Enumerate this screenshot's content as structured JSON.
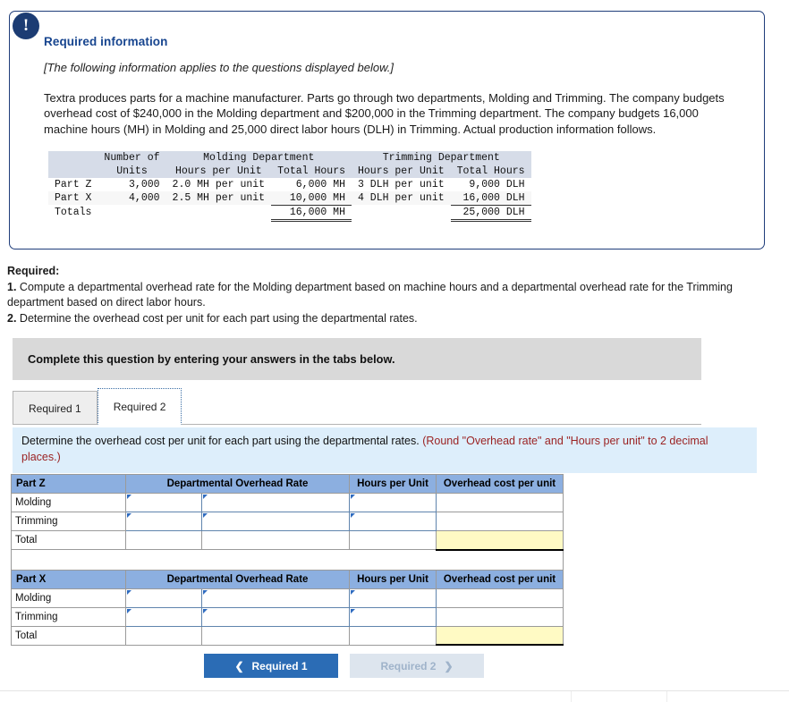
{
  "card": {
    "alert_icon": "exclamation-icon",
    "title": "Required information",
    "italic_note": "[The following information applies to the questions displayed below.]",
    "body": "Textra produces parts for a machine manufacturer. Parts go through two departments, Molding and Trimming. The company budgets overhead cost of $240,000 in the Molding department and $200,000 in the Trimming department. The company budgets 16,000 machine hours (MH) in Molding and 25,000 direct labor hours (DLH) in Trimming. Actual production information follows."
  },
  "data_table": {
    "group_headers": {
      "blank": "",
      "number_of": "Number of",
      "molding": "Molding Department",
      "trimming": "Trimming Department"
    },
    "sub_headers": {
      "blank": "",
      "units": "Units",
      "molding_hours_per_unit": "Hours per Unit",
      "molding_total_hours": "Total Hours",
      "trimming_hours_per_unit": "Hours per Unit",
      "trimming_total_hours": "Total Hours"
    },
    "rows": [
      {
        "part": "Part Z",
        "units": "3,000",
        "molding_hpu": "2.0 MH per unit",
        "molding_total": "6,000 MH",
        "trimming_hpu": "3 DLH per unit",
        "trimming_total": "9,000 DLH"
      },
      {
        "part": "Part X",
        "units": "4,000",
        "molding_hpu": "2.5 MH per unit",
        "molding_total": "10,000 MH",
        "trimming_hpu": "4 DLH per unit",
        "trimming_total": "16,000 DLH"
      }
    ],
    "totals": {
      "label": "Totals",
      "units": "",
      "molding_hpu": "",
      "molding_total": "16,000 MH",
      "trimming_hpu": "",
      "trimming_total": "25,000 DLH"
    }
  },
  "required": {
    "heading": "Required:",
    "item1_number": "1.",
    "item1_text": "Compute a departmental overhead rate for the Molding department based on machine hours and a departmental overhead rate for the Trimming department based on direct labor hours.",
    "item2_number": "2.",
    "item2_text": "Determine the overhead cost per unit for each part using the departmental rates."
  },
  "complete_bar": {
    "text": "Complete this question by entering your answers in the tabs below."
  },
  "tabs": [
    {
      "label": "Required 1",
      "active": false
    },
    {
      "label": "Required 2",
      "active": true
    }
  ],
  "instruction_strip": {
    "main": "Determine the overhead cost per unit for each part using the departmental rates.",
    "note": "(Round \"Overhead rate\" and \"Hours per unit\" to 2 decimal places.)"
  },
  "answer_tables": [
    {
      "part_label": "Part Z",
      "columns": [
        "Departmental Overhead Rate",
        "Hours per Unit",
        "Overhead cost per unit"
      ],
      "rows": [
        {
          "label": "Molding",
          "rate_a": "",
          "rate_b": "",
          "hours": "",
          "cost": ""
        },
        {
          "label": "Trimming",
          "rate_a": "",
          "rate_b": "",
          "hours": "",
          "cost": ""
        }
      ],
      "total_row": {
        "label": "Total",
        "rate_a": "",
        "rate_b": "",
        "hours": "",
        "cost": ""
      }
    },
    {
      "part_label": "Part X",
      "columns": [
        "Departmental Overhead Rate",
        "Hours per Unit",
        "Overhead cost per unit"
      ],
      "rows": [
        {
          "label": "Molding",
          "rate_a": "",
          "rate_b": "",
          "hours": "",
          "cost": ""
        },
        {
          "label": "Trimming",
          "rate_a": "",
          "rate_b": "",
          "hours": "",
          "cost": ""
        }
      ],
      "total_row": {
        "label": "Total",
        "rate_a": "",
        "rate_b": "",
        "hours": "",
        "cost": ""
      }
    }
  ],
  "nav": {
    "prev_label": "Required 1",
    "prev_chevron": "chevron-left-icon",
    "next_label": "Required 2",
    "next_chevron": "chevron-right-icon"
  },
  "colors": {
    "card_border": "#1f3d7a",
    "title_blue": "#17458f",
    "table_header_blue": "#8cafe0",
    "data_header_gray": "#d6dce8",
    "strip_blue": "#ddeefb",
    "note_red": "#9b2323",
    "total_yellow": "#fffac4",
    "primary_button": "#2b6cb5",
    "disabled_button": "#dde5ee"
  }
}
